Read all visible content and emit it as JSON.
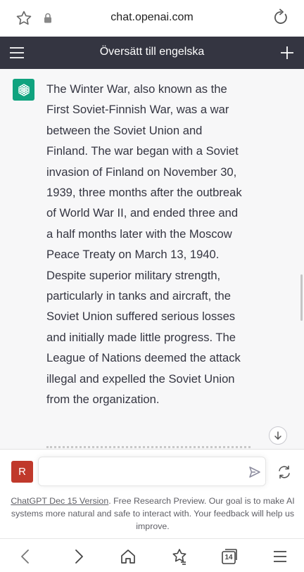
{
  "browser": {
    "url": "chat.openai.com",
    "icons": [
      "star-icon",
      "lock-icon",
      "reload-icon"
    ]
  },
  "header": {
    "title": "Översätt till engelska",
    "icons": [
      "menu-icon",
      "plus-icon"
    ]
  },
  "message": {
    "text": "The Winter War, also known as the First Soviet-Finnish War, was a war between the Soviet Union and Finland. The war began with a Soviet invasion of Finland on November 30, 1939, three months after the outbreak of World War II, and ended three and a half months later with the Moscow Peace Treaty on March 13, 1940. Despite superior military strength, particularly in tanks and aircraft, the Soviet Union suffered serious losses and initially made little progress. The League of Nations deemed the attack illegal and expelled the Soviet Union from the organization."
  },
  "user": {
    "avatar_letter": "R"
  },
  "input": {
    "value": "",
    "placeholder": ""
  },
  "footer": {
    "link": "ChatGPT Dec 15 Version",
    "text": ". Free Research Preview. Our goal is to make AI systems more natural and safe to interact with. Your feedback will help us improve."
  },
  "toolbar": {
    "tab_count": "14"
  },
  "colors": {
    "header_bg": "#343541",
    "chat_bg": "#f7f7f8",
    "gpt_green": "#10a37f",
    "user_red": "#c0392b"
  }
}
